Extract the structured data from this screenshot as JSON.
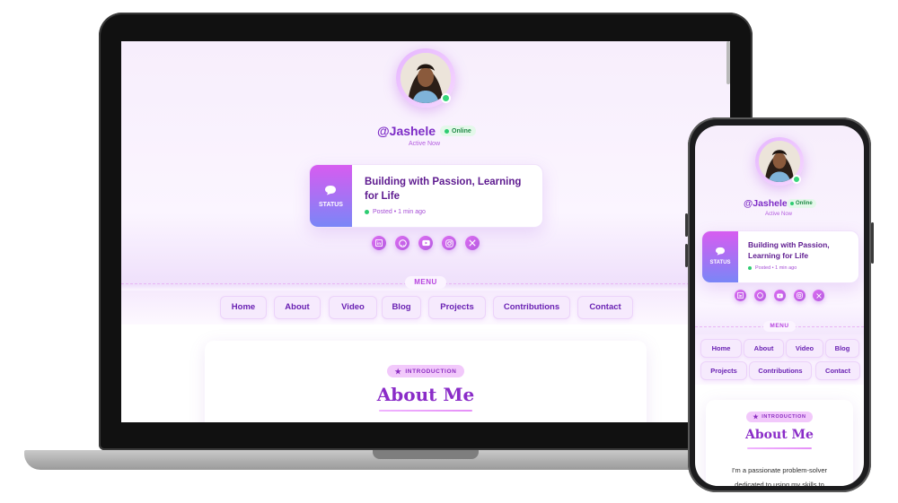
{
  "profile": {
    "handle": "@Jashele",
    "online_badge": "Online",
    "active_status": "Active Now"
  },
  "status": {
    "side_label": "STATUS",
    "title": "Building with Passion, Learning for Life",
    "posted": "Posted • 1 min ago"
  },
  "socials": [
    {
      "name": "linkedin-icon",
      "glyph": "in"
    },
    {
      "name": "github-icon",
      "glyph": "gh"
    },
    {
      "name": "youtube-icon",
      "glyph": "yt"
    },
    {
      "name": "instagram-icon",
      "glyph": "ig"
    },
    {
      "name": "x-icon",
      "glyph": "x"
    }
  ],
  "menu": {
    "label": "MENU",
    "items": [
      "Home",
      "About",
      "Video",
      "Blog",
      "Projects",
      "Contributions",
      "Contact"
    ]
  },
  "about": {
    "pill": "INTRODUCTION",
    "title": "About Me",
    "text": "I'm a passionate problem-solver dedicated to using my skills to"
  },
  "colors": {
    "accent": "#8a2cc8",
    "online": "#2ecc71",
    "status_gradient_top": "#d75cf0",
    "status_gradient_bottom": "#7a86f7"
  }
}
